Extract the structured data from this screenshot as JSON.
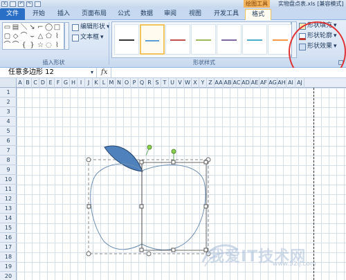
{
  "titlebar": {
    "context_tool": "绘图工具",
    "doc_title": "实物盘点表.xls [兼容模式]"
  },
  "tabs": [
    {
      "label": "文件"
    },
    {
      "label": "开始"
    },
    {
      "label": "插入"
    },
    {
      "label": "页面布局"
    },
    {
      "label": "公式"
    },
    {
      "label": "数据"
    },
    {
      "label": "审阅"
    },
    {
      "label": "视图"
    },
    {
      "label": "开发工具"
    },
    {
      "label": "格式"
    }
  ],
  "ribbon": {
    "insert_shapes": {
      "edit_shape_label": "编辑形状",
      "textbox_label": "文本框",
      "group_label": "插入形状",
      "gallery_glyphs": [
        "▭",
        "▤",
        "＼",
        "↘",
        "⌐",
        "◯",
        "□",
        "▢",
        "◇",
        "⌒",
        "⌣",
        "△",
        "⬠",
        "⌇",
        "⌒",
        "⌒",
        "{",
        "}",
        "☆",
        "◌",
        "⌇",
        "⌒"
      ]
    },
    "shape_styles": {
      "group_label": "形状样式",
      "style_colors": [
        "#333333",
        "#5b9bd5",
        "#c0504d",
        "#9bbb59",
        "#8064a2",
        "#4bacc6",
        "#f79646"
      ],
      "selected_index": 1,
      "fill_label": "形状填充",
      "outline_label": "形状轮廓",
      "effects_label": "形状效果"
    }
  },
  "formula_bar": {
    "name_box": "任意多边形 12",
    "fx": "fx",
    "formula": ""
  },
  "sheet": {
    "columns": [
      "A",
      "B",
      "C",
      "D",
      "E",
      "F",
      "G",
      "H",
      "I",
      "J",
      "K",
      "L",
      "M",
      "N",
      "O",
      "P",
      "Q",
      "R",
      "S",
      "T",
      "U",
      "V",
      "W",
      "X",
      "Y",
      "Z",
      "AA",
      "AB",
      "AC",
      "AD",
      "AE",
      "AF",
      "AG",
      "AH",
      "AI",
      "AJ"
    ],
    "rows": [
      "1",
      "2",
      "3",
      "4",
      "5",
      "6",
      "7",
      "8",
      "9",
      "10",
      "11",
      "12",
      "13",
      "14",
      "15",
      "16",
      "17",
      "18",
      "19",
      "20"
    ]
  },
  "drawing": {
    "leaf_color": "#4f81bd",
    "apple_outline_color": "#6d8fb3"
  },
  "watermark": {
    "text": "我爱IT技术网",
    "url": "www.52ij.com"
  }
}
